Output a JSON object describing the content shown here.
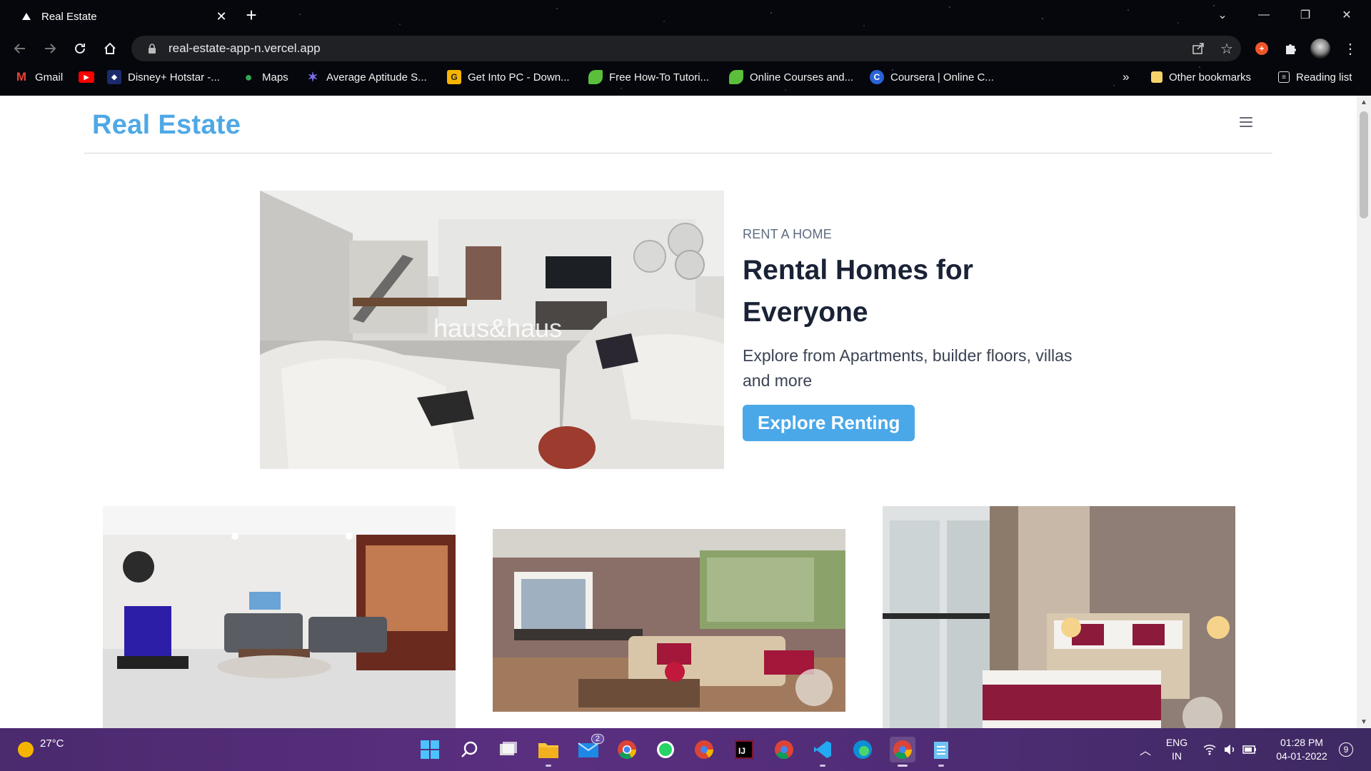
{
  "browser": {
    "tab_title": "Real Estate",
    "url": "real-estate-app-n.vercel.app",
    "bookmarks": [
      {
        "label": "Gmail",
        "icon": "gmail-icon"
      },
      {
        "label": "",
        "icon": "youtube-icon"
      },
      {
        "label": "Disney+ Hotstar -...",
        "icon": "hotstar-icon"
      },
      {
        "label": "Maps",
        "icon": "maps-icon"
      },
      {
        "label": "Average Aptitude S...",
        "icon": "aptitude-icon"
      },
      {
        "label": "Get Into PC - Down...",
        "icon": "getintopc-icon"
      },
      {
        "label": "Free How-To Tutori...",
        "icon": "leaf-icon"
      },
      {
        "label": "Online Courses and...",
        "icon": "leaf-icon"
      },
      {
        "label": "Coursera | Online C...",
        "icon": "coursera-icon"
      }
    ],
    "overflow_label": "»",
    "other_bookmarks": "Other bookmarks",
    "reading_list": "Reading list"
  },
  "page": {
    "brand": "Real Estate",
    "hero": {
      "eyebrow": "RENT A HOME",
      "headline": "Rental Homes for Everyone",
      "description": "Explore from Apartments, builder floors, villas and more",
      "cta": "Explore Renting",
      "image_watermark": "haus&haus"
    }
  },
  "taskbar": {
    "weather": "27°C",
    "mail_badge": "2",
    "lang_line1": "ENG",
    "lang_line2": "IN",
    "time": "01:28 PM",
    "date": "04-01-2022",
    "notifications": "9"
  },
  "colors": {
    "brand": "#4fa8e6",
    "cta": "#4aa8e8",
    "headline": "#1a2236",
    "taskbar": "#4b2a6e"
  }
}
